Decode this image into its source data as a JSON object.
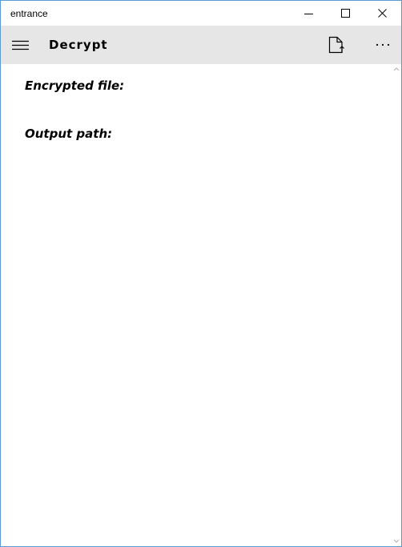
{
  "window": {
    "title": "entrance",
    "controls": [
      "minimize-icon",
      "maximize-icon",
      "close-icon"
    ]
  },
  "commandbar": {
    "menu_icon": "hamburger-icon",
    "page_title": "Decrypt",
    "actions": [
      "open-file-icon",
      "more-icon"
    ]
  },
  "content": {
    "encrypted_file_label": "Encrypted file:",
    "output_path_label": "Output path:"
  },
  "colors": {
    "window_border": "#5b9bd5",
    "commandbar_bg": "#e6e6e6",
    "content_bg": "#ffffff"
  }
}
